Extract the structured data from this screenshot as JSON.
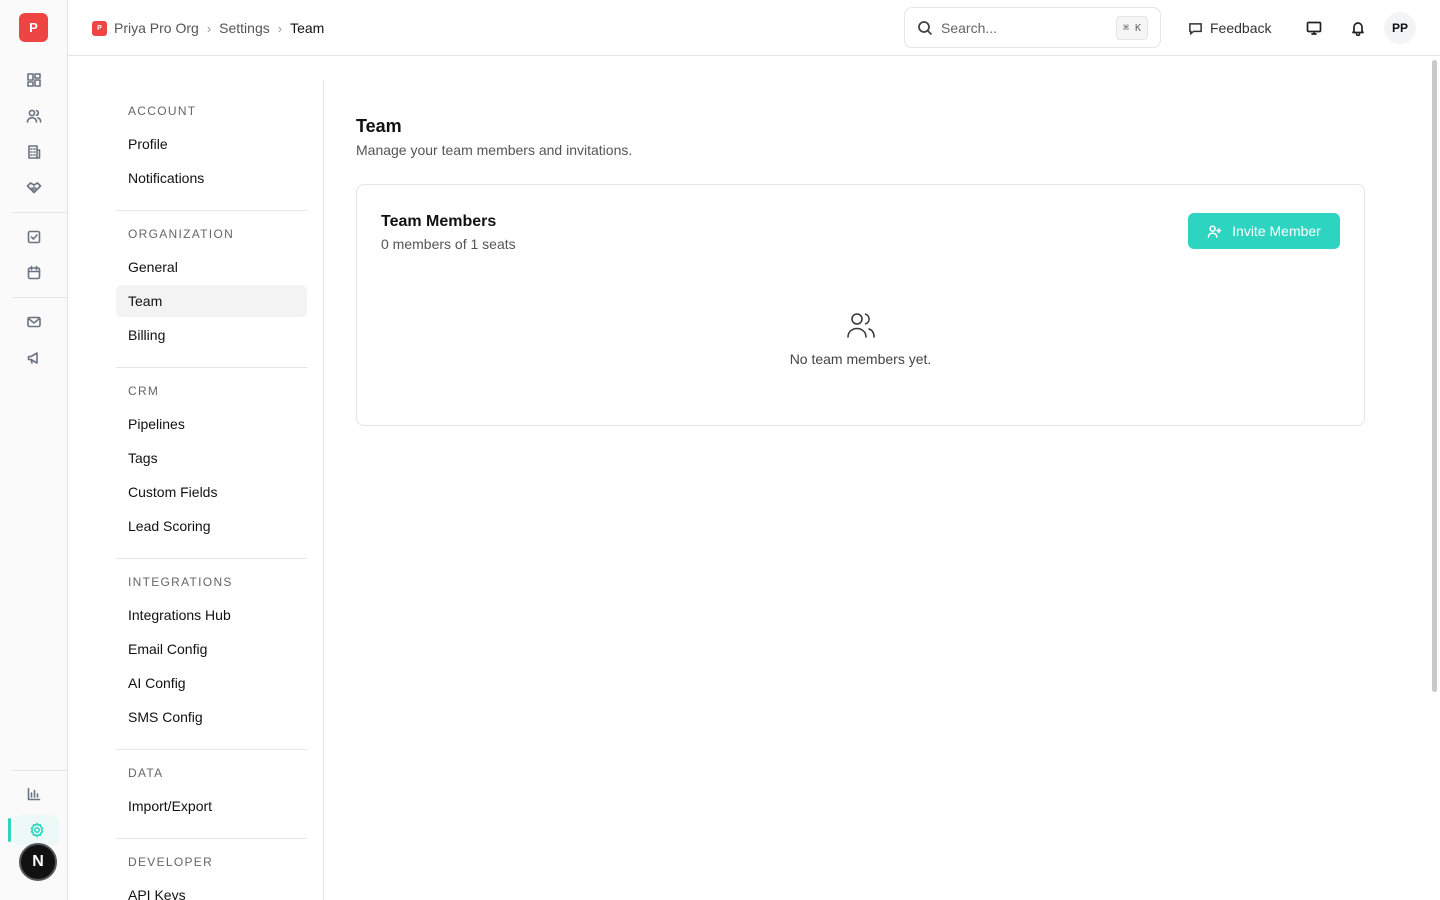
{
  "rail": {
    "logo_letter": "P",
    "bottom_badge": "N",
    "items": [
      "dashboard-icon",
      "contacts-icon",
      "companies-icon",
      "deals-icon",
      "tasks-icon",
      "calendar-icon",
      "email-icon",
      "campaigns-icon",
      "reports-icon",
      "settings-icon"
    ],
    "accent_color": "#2dd4bf"
  },
  "topbar": {
    "breadcrumb": {
      "org_logo": "P",
      "org": "Priya Pro Org",
      "section": "Settings",
      "current": "Team"
    },
    "search": {
      "placeholder": "Search...",
      "shortcut": "⌘ K"
    },
    "feedback_label": "Feedback",
    "avatar_initials": "PP"
  },
  "settings_nav": {
    "account": {
      "heading": "ACCOUNT",
      "items": [
        "Profile",
        "Notifications"
      ]
    },
    "organization": {
      "heading": "ORGANIZATION",
      "items": [
        "General",
        "Team",
        "Billing"
      ],
      "active": "Team"
    },
    "crm": {
      "heading": "CRM",
      "items": [
        "Pipelines",
        "Tags",
        "Custom Fields",
        "Lead Scoring"
      ]
    },
    "integrations": {
      "heading": "INTEGRATIONS",
      "items": [
        "Integrations Hub",
        "Email Config",
        "AI Config",
        "SMS Config"
      ]
    },
    "data": {
      "heading": "DATA",
      "items": [
        "Import/Export"
      ]
    },
    "developer": {
      "heading": "DEVELOPER",
      "items": [
        "API Keys"
      ]
    }
  },
  "main": {
    "title": "Team",
    "subtitle": "Manage your team members and invitations.",
    "card": {
      "title": "Team Members",
      "subtitle": "0 members of 1 seats",
      "invite_label": "Invite Member",
      "empty_text": "No team members yet."
    }
  },
  "colors": {
    "accent": "#2dd4bf",
    "brand_red": "#ef4444"
  }
}
